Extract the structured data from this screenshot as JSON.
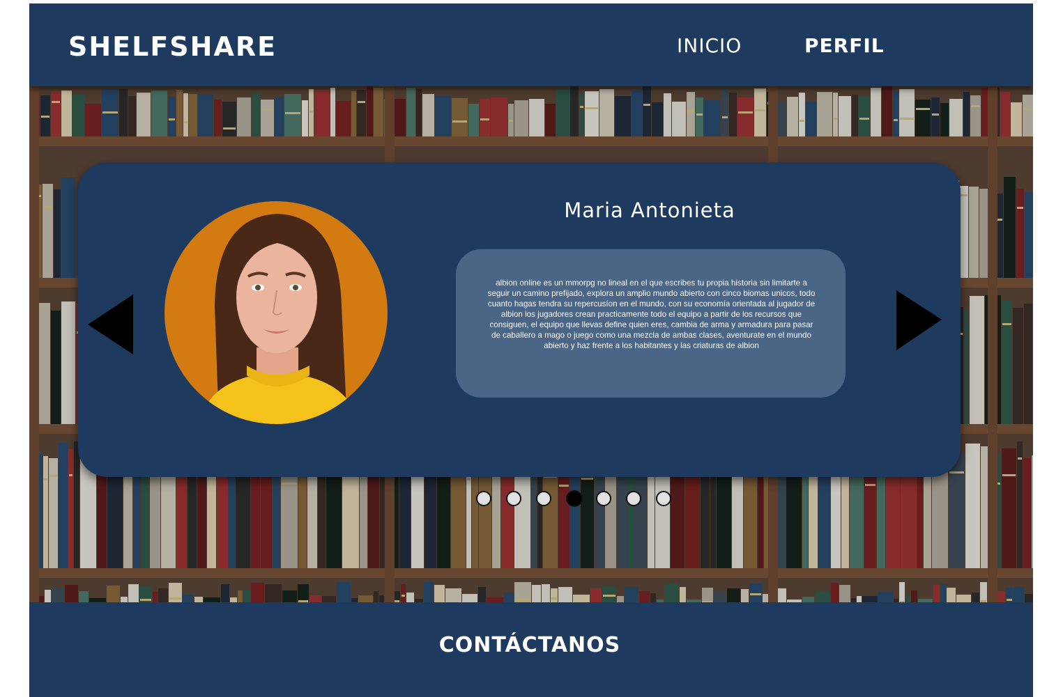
{
  "header": {
    "brand": "SHELFSHARE",
    "nav": {
      "inicio": "INICIO",
      "perfil": "PERFIL"
    }
  },
  "profile": {
    "name": "Maria Antonieta",
    "bio": "albion online es un mmorpg no lineal en el que escribes tu propia historia sin limitarte a seguir un camino prefijado, explora un amplio mundo abierto con cinco biomas unicos, todo cuanto hagas tendra su repercusíon en el mundo, con su economía orientada al jugador de albion los jugadores crean practicamente todo el equipo a partir de los recursos que consiguen, el equipo que llevas define quien eres, cambia de arma y armadura para pasar de caballero a mago o juego como una mezcla de ambas clases, aventurate en el mundo abierto y haz frente a los habitantes y las criaturas de albion"
  },
  "carousel": {
    "total": 7,
    "active_index": 3
  },
  "footer": {
    "contact": "CONTÁCTANOS"
  },
  "colors": {
    "primary": "#1f3a5f",
    "bio_box": "#4a6585",
    "avatar_bg": "#d37a10",
    "sweater": "#f4c21b"
  }
}
